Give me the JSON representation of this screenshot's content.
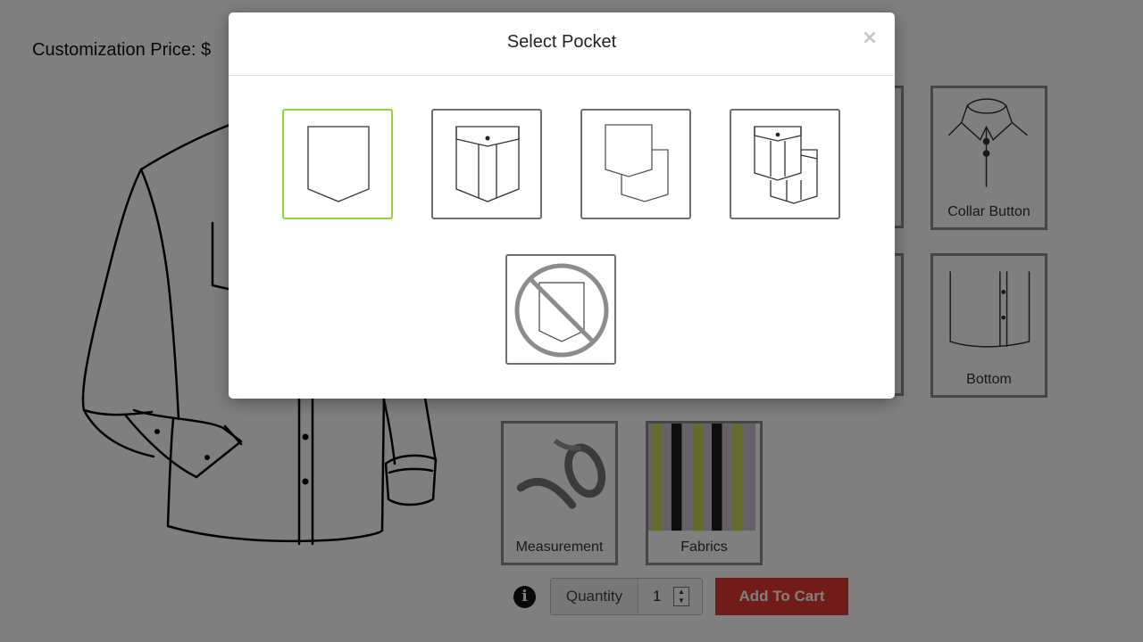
{
  "page": {
    "price_label": "Customization Price: $"
  },
  "tiles": {
    "collar_button": "Collar Button",
    "bottom": "Bottom",
    "measurement": "Measurement",
    "fabrics": "Fabrics"
  },
  "cart": {
    "quantity_label": "Quantity",
    "quantity_value": "1",
    "add_to_cart": "Add To Cart",
    "info_icon": "i"
  },
  "modal": {
    "title": "Select Pocket",
    "close_glyph": "×",
    "options": [
      {
        "name": "single-pointed-pocket",
        "selected": true
      },
      {
        "name": "flap-pocket",
        "selected": false
      },
      {
        "name": "double-pointed-pocket",
        "selected": false
      },
      {
        "name": "double-flap-pocket",
        "selected": false
      },
      {
        "name": "no-pocket",
        "selected": false
      }
    ]
  },
  "colors": {
    "selected_border": "#8fd43a",
    "add_to_cart_bg": "#e53935",
    "overlay": "rgba(0,0,0,0.5)"
  }
}
